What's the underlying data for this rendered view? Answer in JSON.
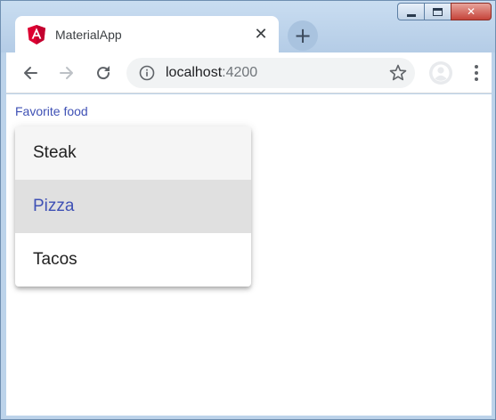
{
  "window": {
    "controls": {
      "minimize": "minimize",
      "maximize": "maximize",
      "close": "✕"
    }
  },
  "tab": {
    "title": "MaterialApp",
    "close_glyph": "✕",
    "favicon": "angular-icon"
  },
  "new_tab_glyph": "+",
  "toolbar": {
    "back": "arrow-left-icon",
    "forward": "arrow-right-icon",
    "reload": "reload-icon",
    "url_host": "localhost",
    "url_port": ":4200",
    "bookmark": "star-icon",
    "profile": "profile-icon",
    "menu": "more-vert-icon"
  },
  "form": {
    "label": "Favorite food",
    "options": [
      {
        "label": "Steak",
        "state": "hover"
      },
      {
        "label": "Pizza",
        "state": "selected"
      },
      {
        "label": "Tacos",
        "state": "normal"
      }
    ]
  },
  "colors": {
    "accent": "#3f51b5",
    "angular_red": "#dd0031",
    "option_selected_bg": "#e0e0e0",
    "option_hover_bg": "#f5f5f5"
  }
}
